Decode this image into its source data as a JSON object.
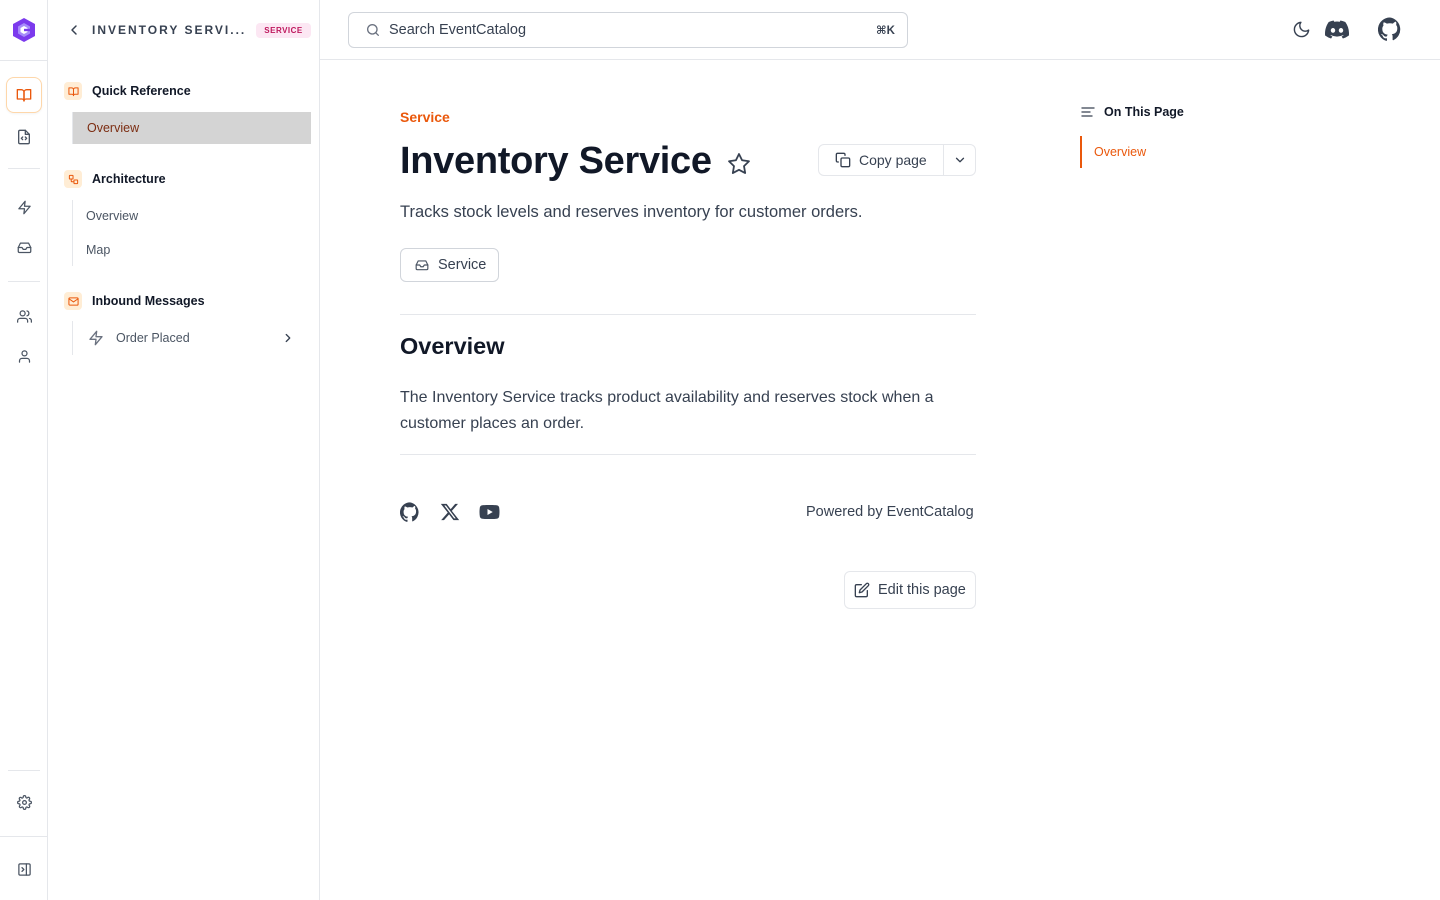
{
  "rail": {
    "logo": "eventcatalog-logo",
    "items": [
      "docs-icon",
      "code-file-icon",
      "bolt-icon",
      "inbox-icon",
      "users-icon",
      "user-icon",
      "settings-icon",
      "sidebar-toggle-icon"
    ]
  },
  "sidebar": {
    "title": "INVENTORY SERVI...",
    "badge": "SERVICE",
    "sections": [
      {
        "label": "Quick Reference",
        "items": [
          "Overview"
        ]
      },
      {
        "label": "Architecture",
        "items": [
          "Overview",
          "Map"
        ]
      },
      {
        "label": "Inbound Messages",
        "items": [
          "Order Placed"
        ]
      }
    ]
  },
  "search": {
    "placeholder": "Search EventCatalog",
    "shortcut": "⌘K"
  },
  "main": {
    "eyebrow": "Service",
    "title": "Inventory Service",
    "copy_label": "Copy page",
    "description": "Tracks stock levels and reserves inventory for customer orders.",
    "badge": "Service",
    "section_heading": "Overview",
    "paragraph": "The Inventory Service tracks product availability and reserves stock when a customer places an order.",
    "powered_by": "Powered by EventCatalog",
    "edit_label": "Edit this page"
  },
  "toc": {
    "heading": "On This Page",
    "items": [
      "Overview"
    ]
  },
  "colors": {
    "accent": "#ea580c",
    "badge_bg": "#fce7f3",
    "badge_text": "#be185d",
    "active_nav_bg": "#d4d4d4"
  }
}
